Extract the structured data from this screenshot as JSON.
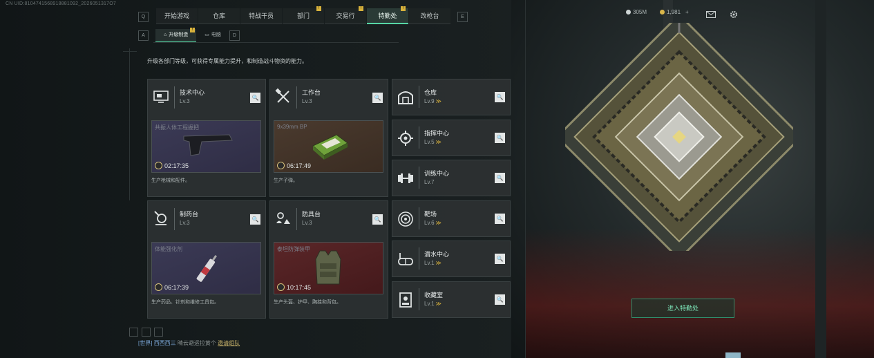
{
  "uid": "CN UID:8104741568918881092_2026051317O7",
  "nav": {
    "tabs": [
      {
        "label": "开始游戏",
        "badge": ""
      },
      {
        "label": "仓库",
        "badge": ""
      },
      {
        "label": "特战干员",
        "badge": ""
      },
      {
        "label": "部门",
        "badge": "!"
      },
      {
        "label": "交易行",
        "badge": "!"
      },
      {
        "label": "特勤处",
        "badge": "!",
        "active": true
      },
      {
        "label": "改枪台",
        "badge": ""
      }
    ],
    "prev_key": "Q",
    "next_key": "E"
  },
  "resources": {
    "currency1": "305M",
    "currency2": "1,981",
    "plus": "+"
  },
  "subnav": {
    "prev_key": "A",
    "tab1": "升级制造",
    "tab1_badge": "!",
    "tab2": "电脑",
    "next_key": "D"
  },
  "description": "升级各部门等级，可获得专属能力提升，和制造战斗物资的能力。",
  "big_cards": [
    {
      "name": "技术中心",
      "level": "Lv.3",
      "item": "共振人体工程握把",
      "timer": "02:17:35",
      "desc": "生产枪械和配件。",
      "color": "purple",
      "icon": "monitor-icon"
    },
    {
      "name": "工作台",
      "level": "Lv.3",
      "item": "9x39mm BP",
      "timer": "06:17:49",
      "desc": "生产子弹。",
      "color": "brown",
      "icon": "tools-icon"
    },
    {
      "name": "制药台",
      "level": "Lv.3",
      "item": "体能强化剂",
      "timer": "06:17:39",
      "desc": "生产药品、针剂和维修工具包。",
      "color": "purple",
      "icon": "microscope-icon"
    },
    {
      "name": "防具台",
      "level": "Lv.3",
      "item": "泰坦防弹装甲",
      "timer": "10:17:45",
      "desc": "生产头盔、护甲、胸挂和背包。",
      "color": "red",
      "icon": "armor-parts-icon"
    }
  ],
  "small_cards": [
    {
      "name": "仓库",
      "level": "Lv.9",
      "upgrade": true,
      "icon": "warehouse-icon"
    },
    {
      "name": "指挥中心",
      "level": "Lv.5",
      "upgrade": true,
      "icon": "command-icon"
    },
    {
      "name": "训练中心",
      "level": "Lv.7",
      "upgrade": false,
      "icon": "dumbbell-icon"
    },
    {
      "name": "靶场",
      "level": "Lv.6",
      "upgrade": true,
      "icon": "target-icon"
    },
    {
      "name": "潜水中心",
      "level": "Lv.1",
      "upgrade": true,
      "icon": "diving-mask-icon"
    },
    {
      "name": "收藏室",
      "level": "Lv.1",
      "upgrade": true,
      "icon": "collection-icon"
    }
  ],
  "upgrade_symbol": "≫",
  "search_symbol": "🔍",
  "enter_button": "进入特勤处",
  "chat": {
    "channel": "[世界]",
    "name": "西西西三",
    "text": "晴云避运拉黄个",
    "link": "邀请组队"
  },
  "colors": {
    "accent": "#56d6a5",
    "badge": "#d8b23c",
    "enter": "#7ee8bb"
  }
}
